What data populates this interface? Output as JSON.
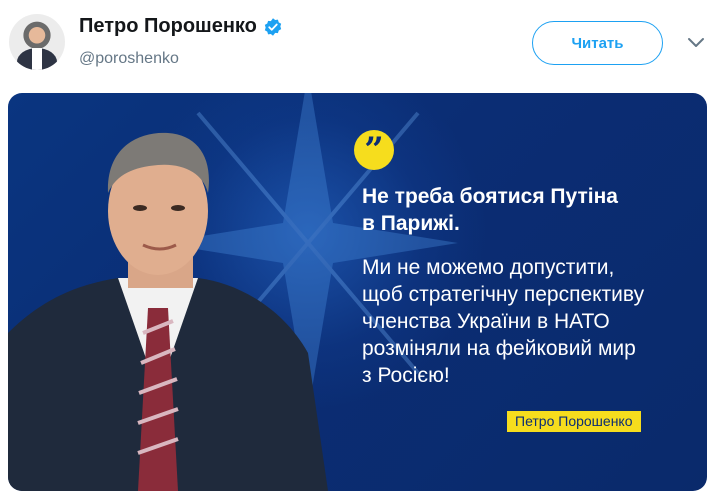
{
  "header": {
    "display_name": "Петро Порошенко",
    "handle": "@poroshenko",
    "follow_label": "Читать",
    "verified_icon": "verified-badge-icon",
    "menu_icon": "chevron-down-icon"
  },
  "media": {
    "headline_line1": "Не треба боятися Путіна",
    "headline_line2": "в Парижі.",
    "body_lines": [
      "Ми не можемо допустити,",
      "щоб стратегічну перспективу",
      "членства України в НАТО",
      "розміняли на фейковий мир",
      "з Росією!"
    ],
    "author_tag": "Петро Порошенко",
    "quote_icon": "quote-icon",
    "colors": {
      "background": "#0b2d74",
      "accent_yellow": "#f6dd1d",
      "twitter_blue": "#1da1f2"
    }
  }
}
